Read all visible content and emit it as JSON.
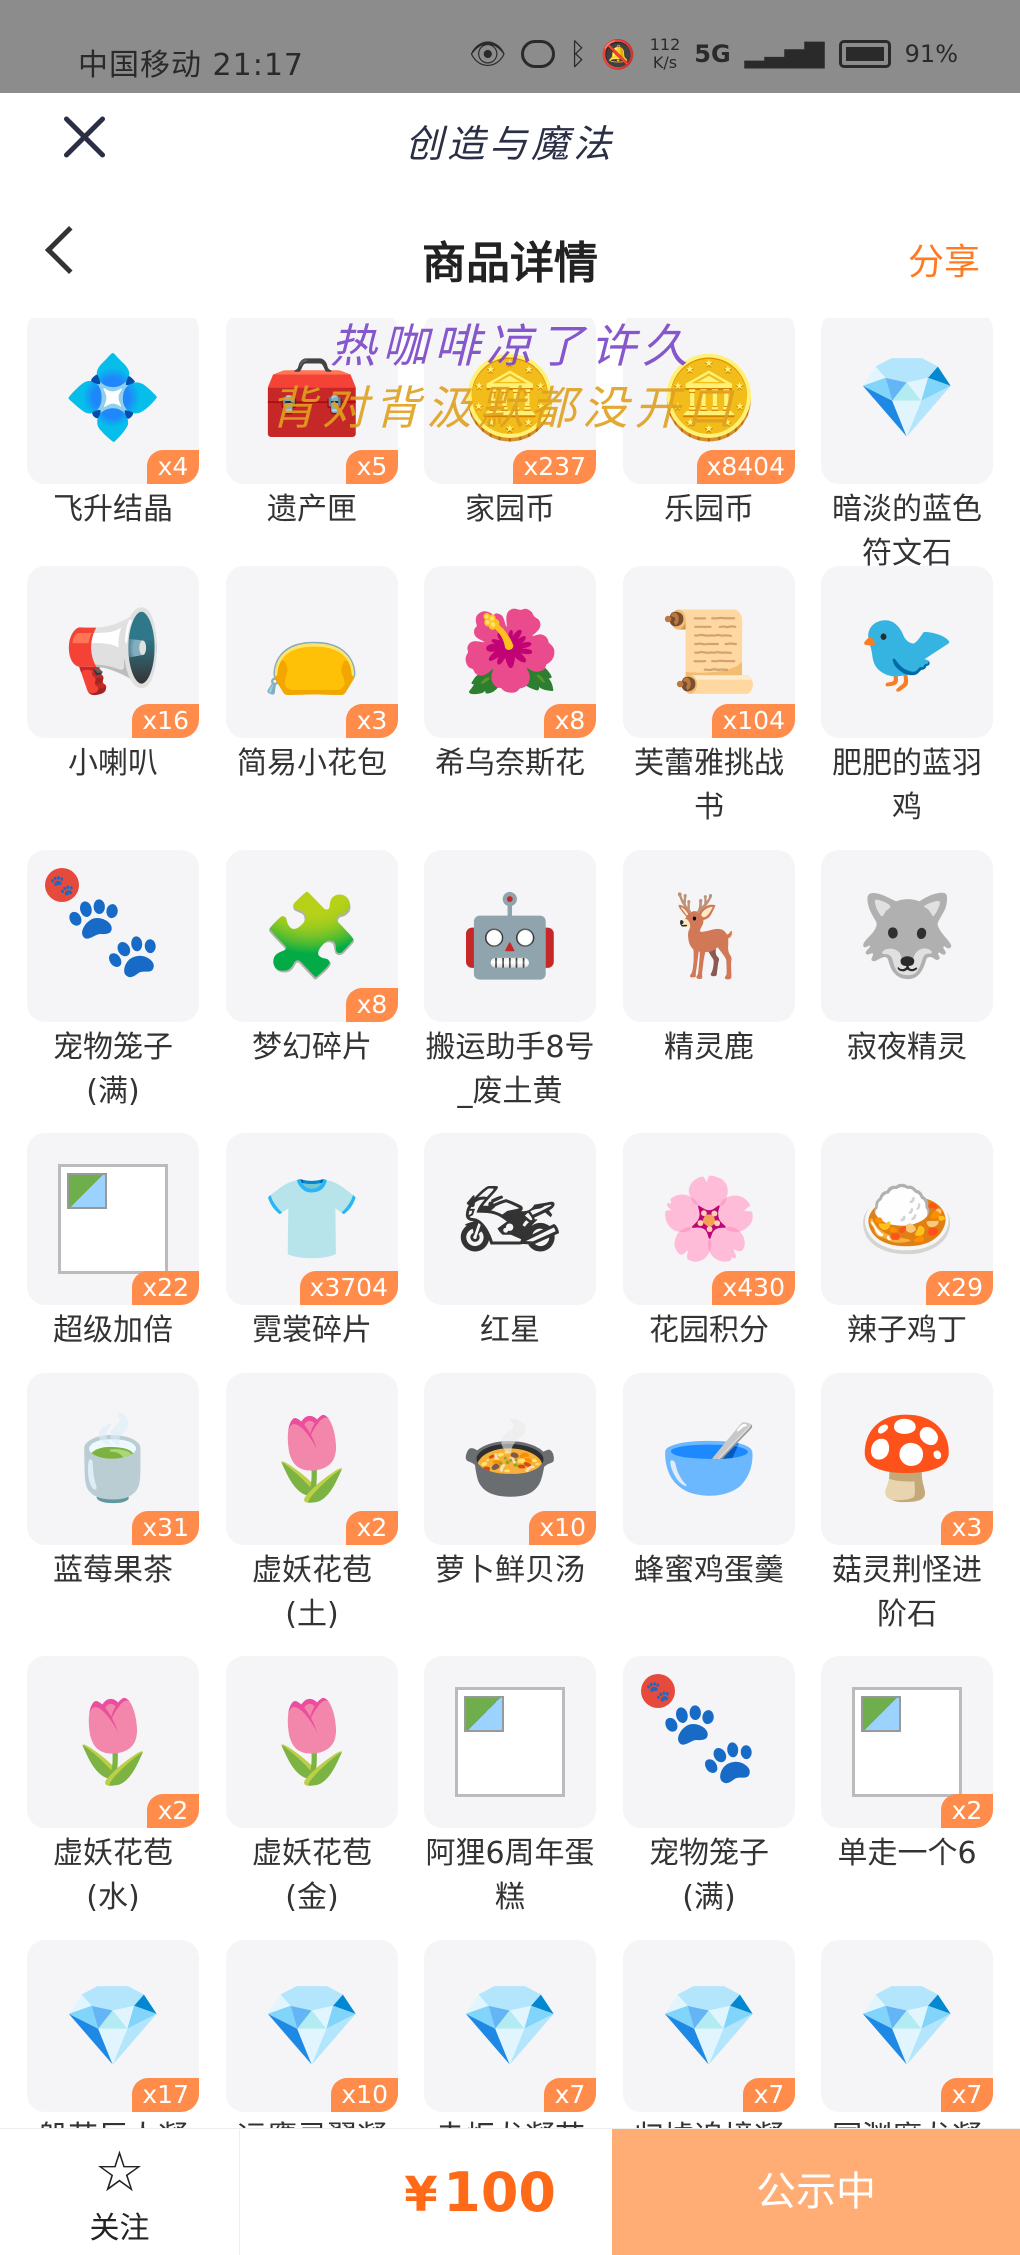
{
  "status_bar": {
    "carrier_time": "中国移动 21:17",
    "net_speed_top": "112",
    "net_speed_bottom": "K/s",
    "network": "5G",
    "battery": "91%"
  },
  "app_bar": {
    "title": "创造与魔法"
  },
  "header": {
    "title": "商品详情",
    "share_label": "分享"
  },
  "watermark": {
    "line1": "热咖啡凉了许久",
    "line2": "背对背汲默都没开口"
  },
  "items": [
    {
      "name": "飞升结晶",
      "count": "x4",
      "icon": "crystal-cage-icon",
      "glyph": "💠"
    },
    {
      "name": "遗产匣",
      "count": "x5",
      "icon": "treasure-chest-icon",
      "glyph": "🧰"
    },
    {
      "name": "家园币",
      "count": "x237",
      "icon": "gold-coin-icon",
      "glyph": "🪙"
    },
    {
      "name": "乐园币",
      "count": "x8404",
      "icon": "gold-coin-icon",
      "glyph": "🪙"
    },
    {
      "name": "暗淡的蓝色符文石",
      "count": "",
      "icon": "blue-rune-stone-icon",
      "glyph": "💎"
    },
    {
      "name": "小喇叭",
      "count": "x16",
      "icon": "megaphone-icon",
      "glyph": "📢"
    },
    {
      "name": "简易小花包",
      "count": "x3",
      "icon": "flower-bag-icon",
      "glyph": "👝"
    },
    {
      "name": "希乌奈斯花",
      "count": "x8",
      "icon": "red-flower-icon",
      "glyph": "🌺"
    },
    {
      "name": "芙蕾雅挑战书",
      "count": "x104",
      "icon": "wanted-poster-icon",
      "glyph": "📜"
    },
    {
      "name": "肥肥的蓝羽鸡",
      "count": "",
      "icon": "blue-bird-icon",
      "glyph": "🐦"
    },
    {
      "name": "宠物笼子(满)",
      "count": "",
      "icon": "pet-cage-icon",
      "glyph": "🐾",
      "tag": true
    },
    {
      "name": "梦幻碎片",
      "count": "x8",
      "icon": "puzzle-piece-icon",
      "glyph": "🧩"
    },
    {
      "name": "搬运助手8号_废土黄",
      "count": "",
      "icon": "robot-icon",
      "glyph": "🤖"
    },
    {
      "name": "精灵鹿",
      "count": "",
      "icon": "spirit-deer-icon",
      "glyph": "🦌"
    },
    {
      "name": "寂夜精灵",
      "count": "",
      "icon": "night-spirit-icon",
      "glyph": "🐺"
    },
    {
      "name": "超级加倍",
      "count": "x22",
      "icon": "broken-image-icon",
      "glyph": "",
      "broken": true
    },
    {
      "name": "霓裳碎片",
      "count": "x3704",
      "icon": "shirt-icon",
      "glyph": "👕"
    },
    {
      "name": "红星",
      "count": "",
      "icon": "motorcycle-icon",
      "glyph": "🏍"
    },
    {
      "name": "花园积分",
      "count": "x430",
      "icon": "flower-badge-icon",
      "glyph": "🌸"
    },
    {
      "name": "辣子鸡丁",
      "count": "x29",
      "icon": "spicy-chicken-icon",
      "glyph": "🍛"
    },
    {
      "name": "蓝莓果茶",
      "count": "x31",
      "icon": "berry-tea-icon",
      "glyph": "🍵"
    },
    {
      "name": "虚妖花苞(土)",
      "count": "x2",
      "icon": "flower-bud-icon",
      "glyph": "🌷"
    },
    {
      "name": "萝卜鲜贝汤",
      "count": "x10",
      "icon": "soup-bowl-icon",
      "glyph": "🍲"
    },
    {
      "name": "蜂蜜鸡蛋羹",
      "count": "",
      "icon": "egg-custard-icon",
      "glyph": "🥣"
    },
    {
      "name": "菇灵荆怪进阶石",
      "count": "x3",
      "icon": "mushroom-gem-icon",
      "glyph": "🍄"
    },
    {
      "name": "虚妖花苞(水)",
      "count": "x2",
      "icon": "flower-bud-icon",
      "glyph": "🌷"
    },
    {
      "name": "虚妖花苞(金)",
      "count": "",
      "icon": "flower-bud-icon",
      "glyph": "🌷"
    },
    {
      "name": "阿狸6周年蛋糕",
      "count": "",
      "icon": "broken-image-icon",
      "glyph": "",
      "broken": true
    },
    {
      "name": "宠物笼子(满)",
      "count": "",
      "icon": "pet-cage-icon",
      "glyph": "🐾",
      "tag": true
    },
    {
      "name": "单走一个6",
      "count": "x2",
      "icon": "broken-image-icon",
      "glyph": "",
      "broken": true
    },
    {
      "name": "般若巨人凝",
      "count": "x17",
      "icon": "blue-crystal-icon",
      "glyph": "💎"
    },
    {
      "name": "远鹰灵翼凝",
      "count": "x10",
      "icon": "blue-crystal-icon",
      "glyph": "💎"
    },
    {
      "name": "赤炬龙凝苗",
      "count": "x7",
      "icon": "blue-crystal-icon",
      "glyph": "💎"
    },
    {
      "name": "归墟追境凝",
      "count": "x7",
      "icon": "blue-crystal-icon",
      "glyph": "💎"
    },
    {
      "name": "冥渊魔龙凝",
      "count": "x7",
      "icon": "blue-crystal-icon",
      "glyph": "💎"
    }
  ],
  "bottom_bar": {
    "follow_label": "关注",
    "price_symbol": "¥",
    "price_value": "100",
    "status_button": "公示中"
  }
}
